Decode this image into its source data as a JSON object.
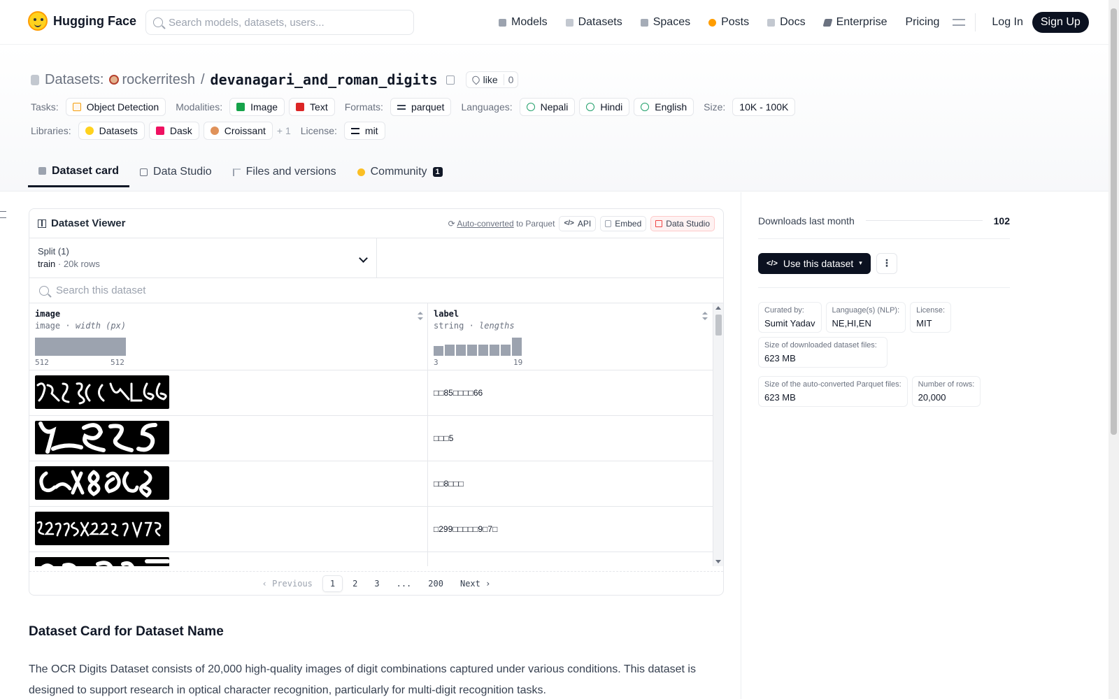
{
  "nav": {
    "brand": "Hugging Face",
    "search_placeholder": "Search models, datasets, users...",
    "links": [
      {
        "label": "Models",
        "icon": "cube-icon",
        "color": "#9ca3af"
      },
      {
        "label": "Datasets",
        "icon": "database-icon",
        "color": "#c3c8d0"
      },
      {
        "label": "Spaces",
        "icon": "spaces-icon",
        "color": "#a5acb7"
      },
      {
        "label": "Posts",
        "icon": "posts-icon",
        "color": "#ff9d00"
      },
      {
        "label": "Docs",
        "icon": "docs-icon",
        "color": "#c3c8d0"
      },
      {
        "label": "Enterprise",
        "icon": "enterprise-icon",
        "color": "#6b7280"
      },
      {
        "label": "Pricing",
        "icon": "",
        "color": ""
      }
    ],
    "login": "Log In",
    "signup": "Sign Up"
  },
  "repo": {
    "type_label": "Datasets:",
    "owner": "rockerritesh",
    "separator": "/",
    "name": "devanagari_and_roman_digits",
    "like_label": "like",
    "like_count": "0"
  },
  "tags": [
    {
      "label": "Tasks:",
      "items": [
        {
          "text": "Object Detection",
          "icon": "object-detection-icon"
        }
      ]
    },
    {
      "label": "Modalities:",
      "items": [
        {
          "text": "Image",
          "icon": "image-icon"
        },
        {
          "text": "Text",
          "icon": "text-icon"
        }
      ]
    },
    {
      "label": "Formats:",
      "items": [
        {
          "text": "parquet",
          "icon": "parquet-icon"
        }
      ]
    },
    {
      "label": "Languages:",
      "items": [
        {
          "text": "Nepali",
          "icon": "globe-icon"
        },
        {
          "text": "Hindi",
          "icon": "globe-icon"
        },
        {
          "text": "English",
          "icon": "globe-icon"
        }
      ]
    },
    {
      "label": "Size:",
      "items": [
        {
          "text": "10K - 100K",
          "icon": ""
        }
      ]
    },
    {
      "label": "Libraries:",
      "items": [
        {
          "text": "Datasets",
          "icon": "hf-icon"
        },
        {
          "text": "Dask",
          "icon": "dask-icon"
        },
        {
          "text": "Croissant",
          "icon": "croissant-icon"
        }
      ],
      "more": "+ 1"
    },
    {
      "label": "License:",
      "items": [
        {
          "text": "mit",
          "icon": "license-icon"
        }
      ]
    }
  ],
  "tabs": [
    {
      "label": "Dataset card",
      "active": true,
      "icon": "dataset-card-icon"
    },
    {
      "label": "Data Studio",
      "active": false,
      "icon": "table-icon"
    },
    {
      "label": "Files and versions",
      "active": false,
      "icon": "files-icon"
    },
    {
      "label": "Community",
      "active": false,
      "icon": "community-icon",
      "badge": "1"
    }
  ],
  "viewer": {
    "title": "Dataset Viewer",
    "auto_converted": "Auto-converted",
    "to_parquet": "to Parquet",
    "api": "API",
    "embed": "Embed",
    "data_studio": "Data Studio",
    "split_label": "Split (1)",
    "split_name": "train",
    "split_dot": "·",
    "split_rows": "20k rows",
    "search_placeholder": "Search this dataset",
    "columns": [
      {
        "name": "image",
        "type": "image",
        "stat": "width (px)",
        "min": "512",
        "max": "512",
        "hist": [
          1.0
        ]
      },
      {
        "name": "label",
        "type": "string",
        "stat": "lengths",
        "min": "3",
        "max": "19",
        "hist": [
          0.55,
          0.62,
          0.6,
          0.6,
          0.6,
          0.6,
          0.6,
          1.0
        ]
      }
    ],
    "rows": [
      {
        "label": "□□85□□□□66"
      },
      {
        "label": "□□□5"
      },
      {
        "label": "□□8□□□"
      },
      {
        "label": "□299□□□□□9□7□"
      },
      {
        "label": ""
      }
    ],
    "pager": {
      "prev": "Previous",
      "pages": [
        "1",
        "2",
        "3",
        "...",
        "200"
      ],
      "active": "1",
      "next": "Next"
    }
  },
  "card": {
    "title": "Dataset Card for Dataset Name",
    "text": "The OCR Digits Dataset consists of 20,000 high-quality images of digit combinations captured under various conditions. This dataset is designed to support research in optical character recognition, particularly for multi-digit recognition tasks."
  },
  "sidebar": {
    "downloads_label": "Downloads last month",
    "downloads_value": "102",
    "use_dataset": "Use this dataset",
    "kebab": "⋮",
    "meta": [
      {
        "k": "Curated by:",
        "v": "Sumit Yadav"
      },
      {
        "k": "Language(s) (NLP):",
        "v": "NE,HI,EN"
      },
      {
        "k": "License:",
        "v": "MIT"
      },
      {
        "k": "Size of downloaded dataset files:",
        "v": "623 MB"
      },
      {
        "k": "Size of the auto-converted Parquet files:",
        "v": "623 MB"
      },
      {
        "k": "Number of rows:",
        "v": "20,000"
      }
    ]
  }
}
